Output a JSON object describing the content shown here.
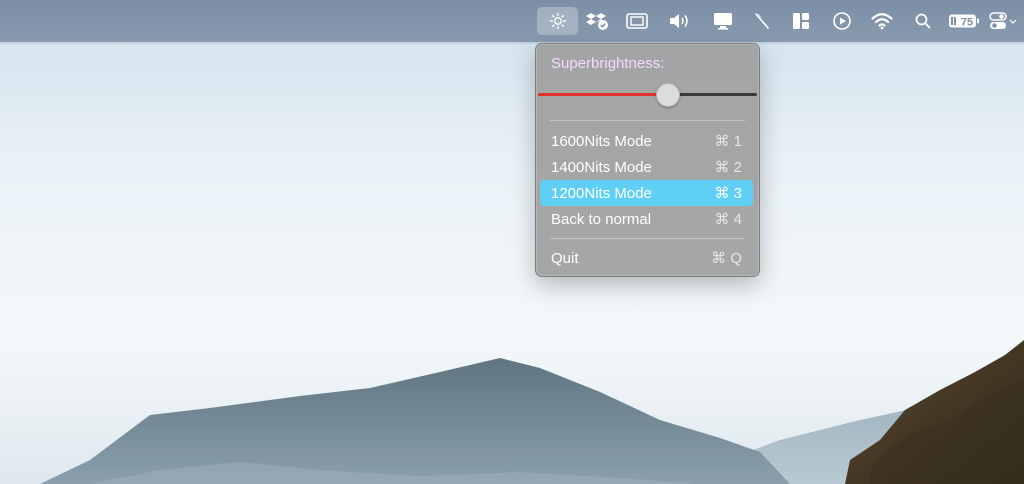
{
  "menubar": {
    "battery_level": "75",
    "icons": [
      {
        "name": "brightness-icon",
        "active": true
      },
      {
        "name": "dropbox-sync-icon"
      },
      {
        "name": "screen-capture-icon"
      },
      {
        "name": "volume-icon"
      },
      {
        "name": "display-icon"
      },
      {
        "name": "pen-icon"
      },
      {
        "name": "window-layout-icon"
      },
      {
        "name": "play-icon"
      },
      {
        "name": "wifi-icon"
      },
      {
        "name": "search-icon"
      },
      {
        "name": "battery-icon"
      },
      {
        "name": "control-center-icon"
      }
    ]
  },
  "popup": {
    "title": "Superbrightness:",
    "slider": {
      "value_fraction": 0.59,
      "fill_color": "#e0332b"
    },
    "items": [
      {
        "label": "1600Nits Mode",
        "shortcut": "⌘ 1"
      },
      {
        "label": "1400Nits Mode",
        "shortcut": "⌘ 2"
      },
      {
        "label": "1200Nits Mode",
        "shortcut": "⌘ 3",
        "highlighted": true
      },
      {
        "label": "Back to normal",
        "shortcut": "⌘ 4"
      }
    ],
    "quit": {
      "label": "Quit",
      "shortcut": "⌘ Q"
    },
    "highlight_color": "#5fcff6"
  }
}
